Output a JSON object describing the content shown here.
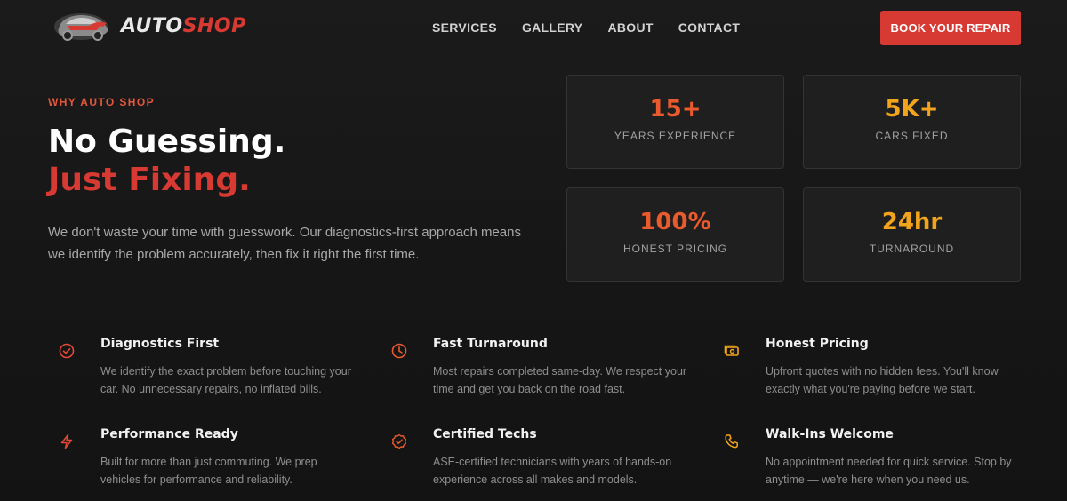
{
  "brand": {
    "name_part1": "AUTO",
    "name_part2": "SHOP"
  },
  "nav": {
    "items": [
      "SERVICES",
      "GALLERY",
      "ABOUT",
      "CONTACT"
    ]
  },
  "cta": {
    "label": "BOOK YOUR REPAIR"
  },
  "hero": {
    "eyebrow": "WHY AUTO SHOP",
    "headline_line1": "No Guessing.",
    "headline_line2": "Just Fixing.",
    "lead": "We don't waste your time with guesswork. Our diagnostics-first approach means we identify the problem accurately, then fix it right the first time."
  },
  "stats": [
    {
      "value": "15+",
      "label": "YEARS EXPERIENCE",
      "color": "#ea5a2c"
    },
    {
      "value": "5K+",
      "label": "CARS FIXED",
      "color": "#f2a51c"
    },
    {
      "value": "100%",
      "label": "HONEST PRICING",
      "color": "#ea5a2c"
    },
    {
      "value": "24hr",
      "label": "TURNAROUND",
      "color": "#f2a51c"
    }
  ],
  "features": [
    {
      "icon": "check-badge-icon",
      "title": "Diagnostics First",
      "text": "We identify the exact problem before touching your car. No unnecessary repairs, no inflated bills."
    },
    {
      "icon": "clock-icon",
      "title": "Fast Turnaround",
      "text": "Most repairs completed same-day. We respect your time and get you back on the road fast."
    },
    {
      "icon": "money-icon",
      "title": "Honest Pricing",
      "text": "Upfront quotes with no hidden fees. You'll know exactly what you're paying before we start."
    },
    {
      "icon": "lightning-icon",
      "title": "Performance Ready",
      "text": "Built for more than just commuting. We prep vehicles for performance and reliability."
    },
    {
      "icon": "check-badge-icon",
      "title": "Certified Techs",
      "text": "ASE-certified technicians with years of hands-on experience across all makes and models."
    },
    {
      "icon": "phone-icon",
      "title": "Walk-Ins Welcome",
      "text": "No appointment needed for quick service. Stop by anytime — we're here when you need us."
    }
  ],
  "colors": {
    "accent_red": "#d63a32",
    "accent_orange": "#ea5a2c",
    "accent_yellow": "#f2a51c"
  }
}
